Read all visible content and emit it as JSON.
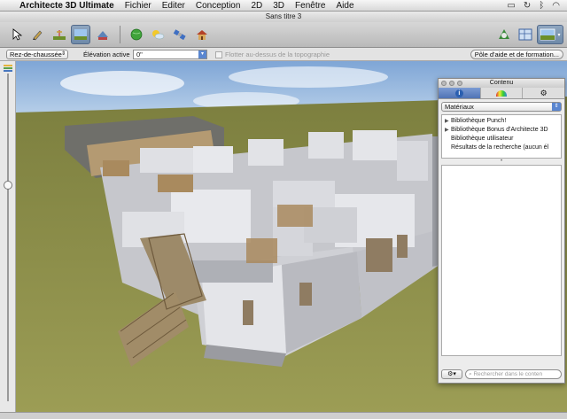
{
  "menubar": {
    "app_name": "Architecte 3D Ultimate",
    "items": [
      "Fichier",
      "Editer",
      "Conception",
      "2D",
      "3D",
      "Fenêtre",
      "Aide"
    ]
  },
  "window": {
    "title": "Sans titre 3"
  },
  "subbar": {
    "floor_value": "Rez-de-chaussée",
    "elevation_label": "Élévation active",
    "elevation_value": "0\"",
    "float_label": "Flotter au-dessus de la topographie",
    "help_button": "Pôle d'aide et de formation..."
  },
  "palette": {
    "title": "Contenu",
    "category": "Matériaux",
    "library_items": [
      {
        "label": "Bibliothèque Punch!",
        "expandable": true
      },
      {
        "label": "Bibliothèque Bonus d'Architecte 3D",
        "expandable": true
      },
      {
        "label": "Bibliothèque utilisateur",
        "expandable": false
      },
      {
        "label": "Résultats de la recherche (aucun él",
        "expandable": false
      }
    ],
    "search_placeholder": "Rechercher dans le conten"
  },
  "colors": {
    "sky_top": "#7fa6d6",
    "grass": "#8a8c4a",
    "wall": "#d6d7dc",
    "accent": "#5a86d0"
  }
}
